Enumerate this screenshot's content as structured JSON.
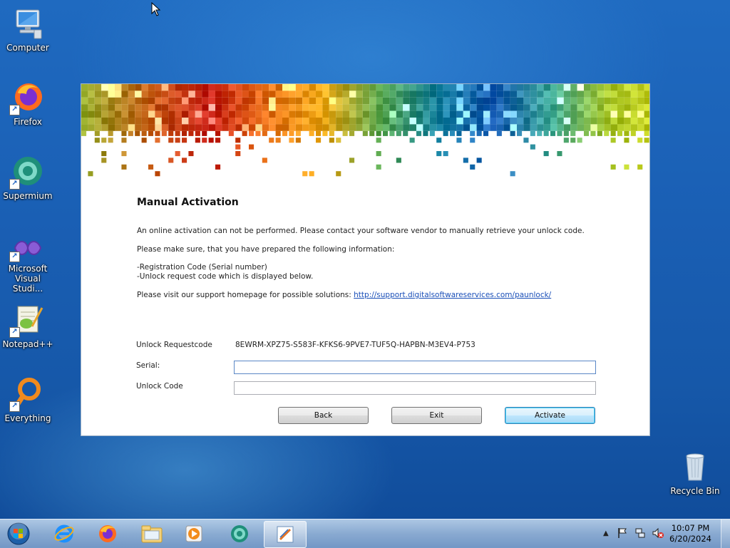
{
  "desktop": {
    "icons": [
      {
        "label": "Computer",
        "icon": "computer-icon"
      },
      {
        "label": "Firefox",
        "icon": "firefox-icon"
      },
      {
        "label": "Supermium",
        "icon": "supermium-icon"
      },
      {
        "label": "Microsoft Visual Studi...",
        "icon": "visual-studio-icon"
      },
      {
        "label": "Notepad++",
        "icon": "notepadpp-icon"
      },
      {
        "label": "Everything",
        "icon": "everything-icon"
      },
      {
        "label": "Recycle Bin",
        "icon": "recycle-bin-icon"
      }
    ]
  },
  "dialog": {
    "title": "Manual Activation",
    "intro": "An online activation can not be performed. Please contact your software vendor to manually retrieve your unlock code.",
    "prepare": "Please make sure, that you have prepared the following information:",
    "item1": "-Registration Code (Serial number)",
    "item2": "-Unlock request code which is displayed below.",
    "visit": "Please visit our support homepage for possible solutions:",
    "link": "http://support.digitalsoftwareservices.com/paunlock/",
    "request_label": "Unlock Requestcode",
    "request_code": "8EWRM-XPZ75-S583F-KFKS6-9PVE7-TUF5Q-HAPBN-M3EV4-P753",
    "serial_label": "Serial:",
    "serial_value": "",
    "unlock_label": "Unlock Code",
    "unlock_value": "",
    "buttons": {
      "back": "Back",
      "exit": "Exit",
      "activate": "Activate"
    }
  },
  "taskbar": {
    "start": "start-orb-icon",
    "pinned": [
      "internet-explorer-icon",
      "firefox-icon",
      "file-explorer-icon",
      "media-player-icon",
      "supermium-icon",
      "activation-app-icon"
    ],
    "tray_icons": [
      "show-hidden-icons-icon",
      "action-center-flag-icon",
      "network-icon",
      "volume-muted-icon"
    ],
    "time": "10:07 PM",
    "date": "6/20/2024"
  }
}
